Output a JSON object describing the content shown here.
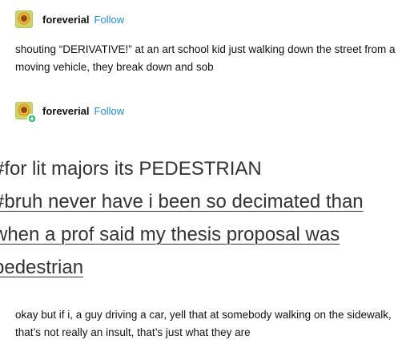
{
  "post1": {
    "username": "foreverial",
    "follow_label": "Follow",
    "text": "shouting “DERIVATIVE!” at an art school kid just walking down the street from a moving vehicle, they break down and sob"
  },
  "post2": {
    "username": "foreverial",
    "follow_label": "Follow",
    "tags": {
      "tag1": "#for lit majors its PEDESTRIAN",
      "tag2_line1": "#bruh never have i been so decimated than",
      "tag2_line2": "when a prof said my thesis proposal was",
      "tag2_line3": "pedestrian"
    },
    "text": "okay but if i, a guy driving a car, yell that at somebody walking on the sidewalk, that’s not really an insult, that’s just what they are"
  },
  "colors": {
    "follow": "#1f8fd6",
    "badge": "#00b35c"
  },
  "icons": {
    "badge": "plus-badge-icon"
  }
}
